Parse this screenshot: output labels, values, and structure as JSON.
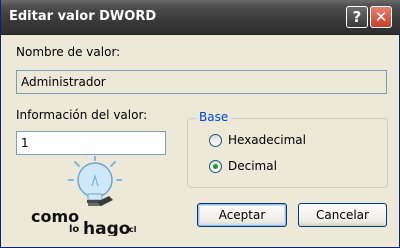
{
  "window": {
    "title": "Editar valor DWORD"
  },
  "titlebar": {
    "help_glyph": "?",
    "close_glyph": "✕"
  },
  "value_name": {
    "label": "Nombre de valor:",
    "value": "Administrador"
  },
  "value_data": {
    "label": "Información del valor:",
    "value": "1"
  },
  "base": {
    "legend": "Base",
    "options": [
      {
        "label": "Hexadecimal",
        "selected": false
      },
      {
        "label": "Decimal",
        "selected": true
      }
    ]
  },
  "buttons": {
    "ok": "Aceptar",
    "cancel": "Cancelar"
  },
  "logo": {
    "word1": "como",
    "word2": "lo",
    "word3": "hago",
    "tld": ".cl"
  },
  "colors": {
    "accent": "#0046d5",
    "radio_dot": "#21a121",
    "close_button": "#c2412a"
  }
}
